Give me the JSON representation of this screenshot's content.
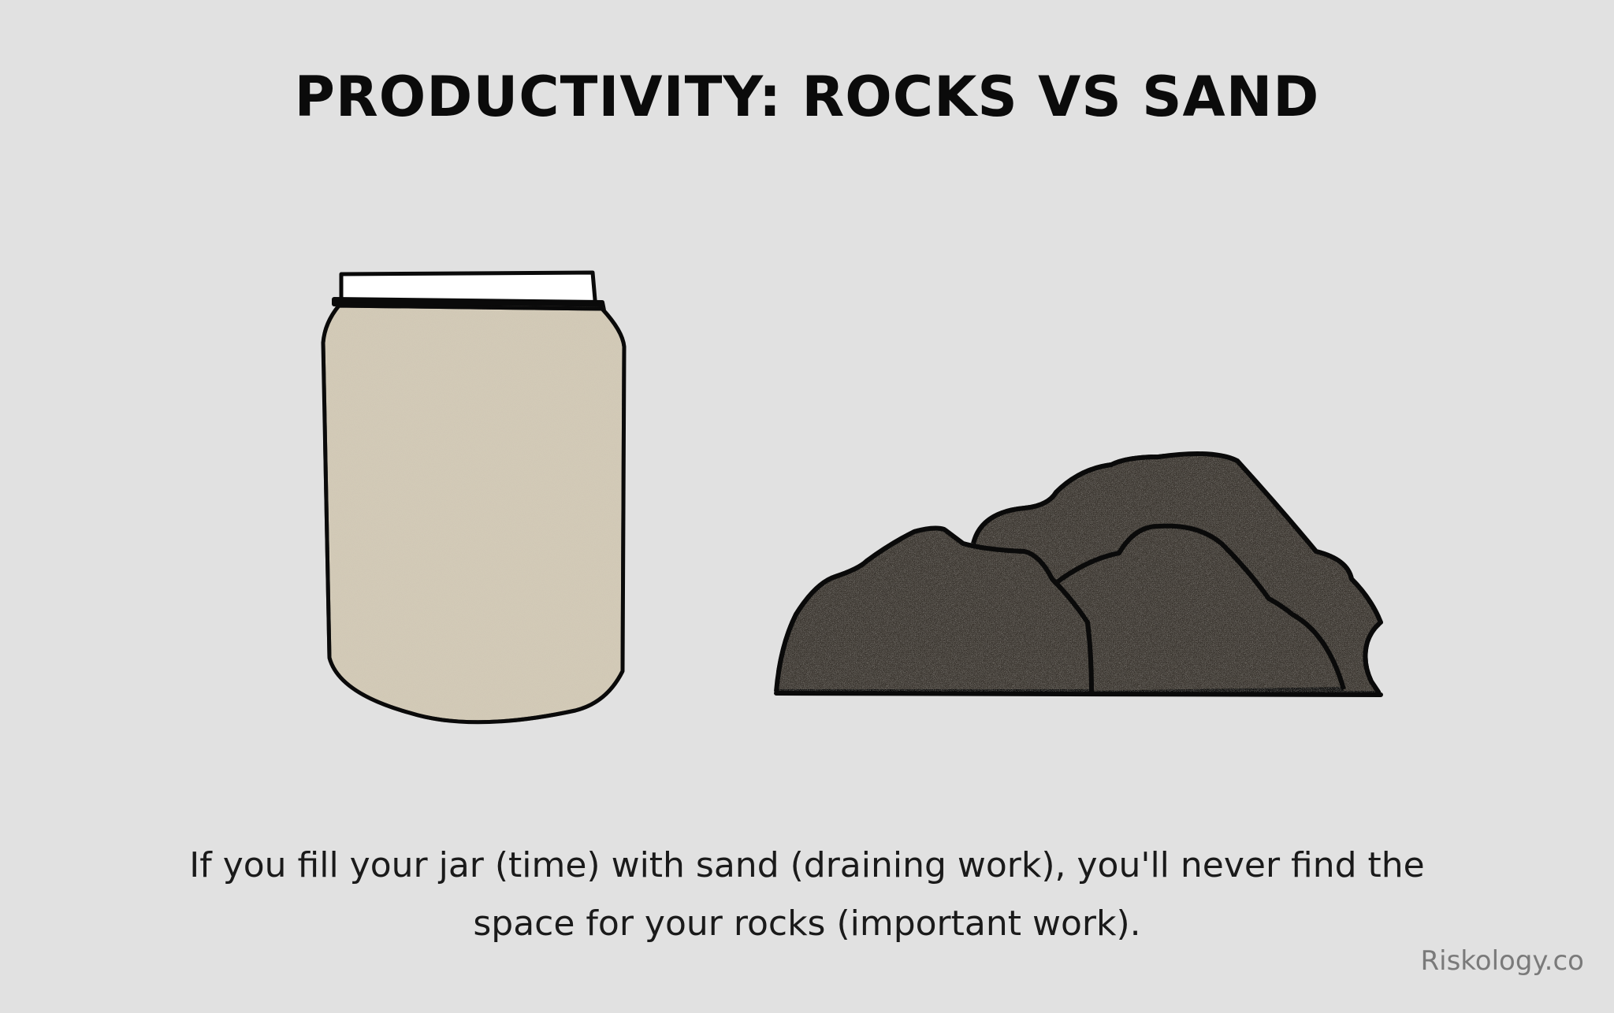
{
  "title": "PRODUCTIVITY: ROCKS VS SAND",
  "caption": {
    "line1": "If you fill your jar (time) with sand (draining work), you'll never find the",
    "line2": "space for your rocks (important work)."
  },
  "credit": "Riskology.co",
  "icons": [
    "jar-of-sand-icon",
    "rock-pile-icon"
  ],
  "colors": {
    "background": "#e1e1e1",
    "sand": "#d6cdb9",
    "rock": "#3d3830",
    "outline": "#0a0a0a"
  }
}
